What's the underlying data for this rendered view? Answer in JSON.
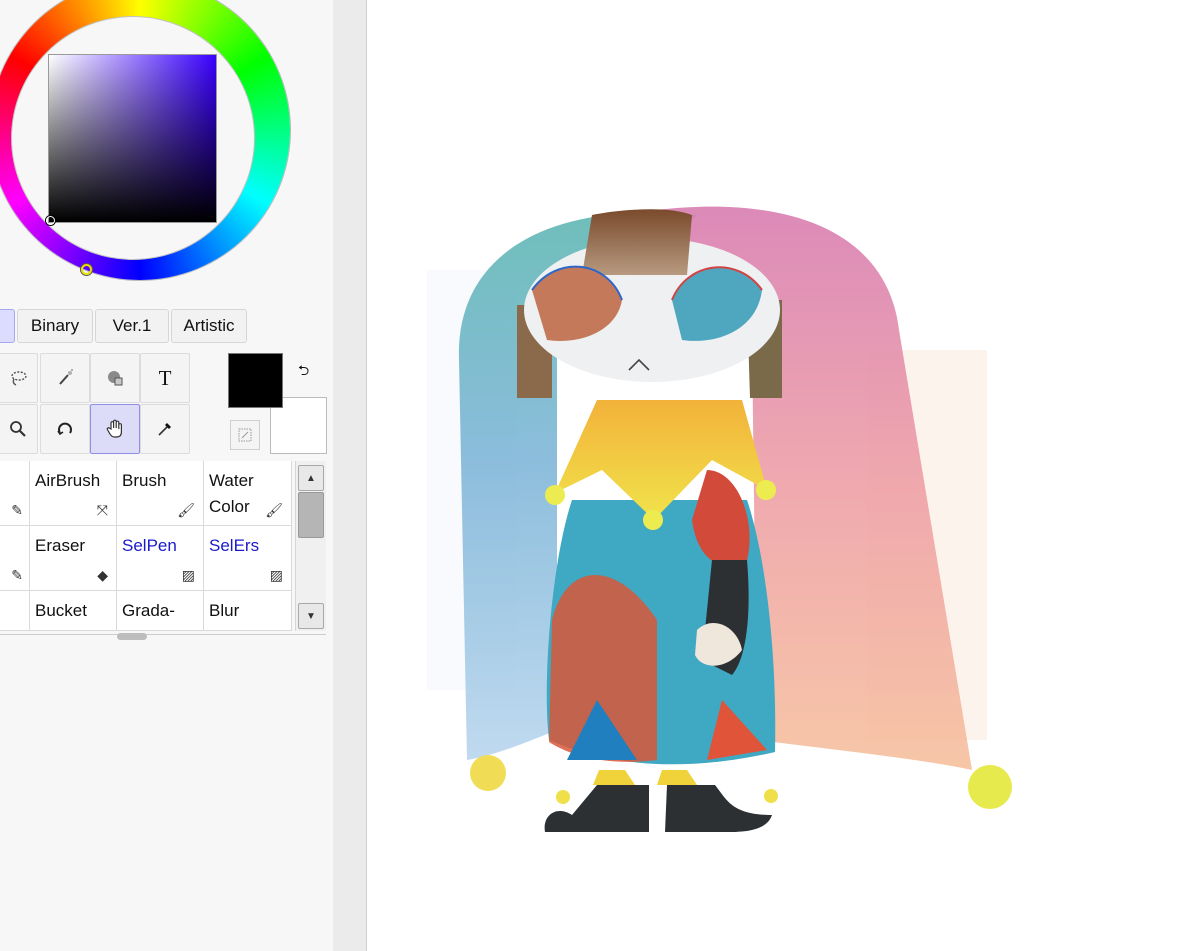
{
  "colors": {
    "foreground": "#000000",
    "background": "#ffffff",
    "selected_hue": "#3a00ff",
    "accent": "#dcdcf8"
  },
  "color_tabs": [
    "",
    "Binary",
    "Ver.1",
    "Artistic"
  ],
  "tools": {
    "icons": [
      "lasso-icon",
      "magic-wand-icon",
      "select-shape-icon",
      "T",
      "zoom-icon",
      "rotate-icon",
      "hand-icon",
      "eyedropper-icon"
    ],
    "text_tool_glyph": "T"
  },
  "brush_grid": {
    "row1": [
      "AirBrush",
      "Brush",
      "Water\nColor"
    ],
    "row2": [
      "Eraser",
      "SelPen",
      "SelErs"
    ],
    "row3": [
      "Bucket",
      "Grada-",
      "Blur"
    ]
  }
}
